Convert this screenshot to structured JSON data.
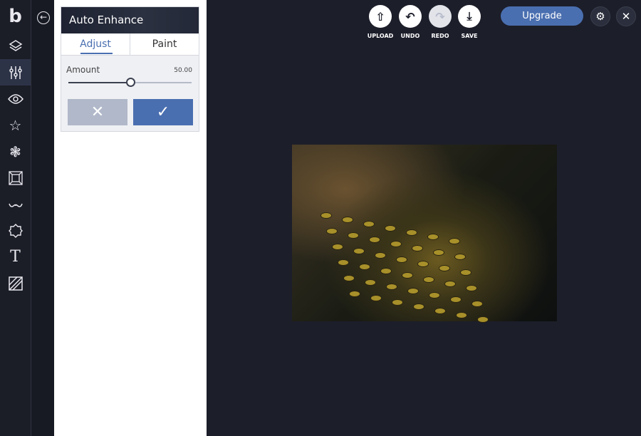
{
  "sidebar": {
    "items": [
      {
        "icon": "logo-icon"
      },
      {
        "icon": "layers-icon"
      },
      {
        "icon": "sliders-icon",
        "active": true
      },
      {
        "icon": "eye-icon"
      },
      {
        "icon": "star-icon"
      },
      {
        "icon": "flower-icon"
      },
      {
        "icon": "frame-icon"
      },
      {
        "icon": "mustache-icon"
      },
      {
        "icon": "badge-icon"
      },
      {
        "icon": "text-icon"
      },
      {
        "icon": "texture-icon"
      }
    ]
  },
  "panel": {
    "title": "Auto Enhance",
    "tabs": [
      "Adjust",
      "Paint"
    ],
    "amount_label": "Amount",
    "amount_value": "50.00",
    "amount_fraction": 0.5
  },
  "toolbar": {
    "upload": "UPLOAD",
    "undo": "UNDO",
    "redo": "REDO",
    "save": "SAVE",
    "upgrade": "Upgrade"
  },
  "colors": {
    "accent": "#4a6fb0",
    "background": "#1c1e2a"
  }
}
